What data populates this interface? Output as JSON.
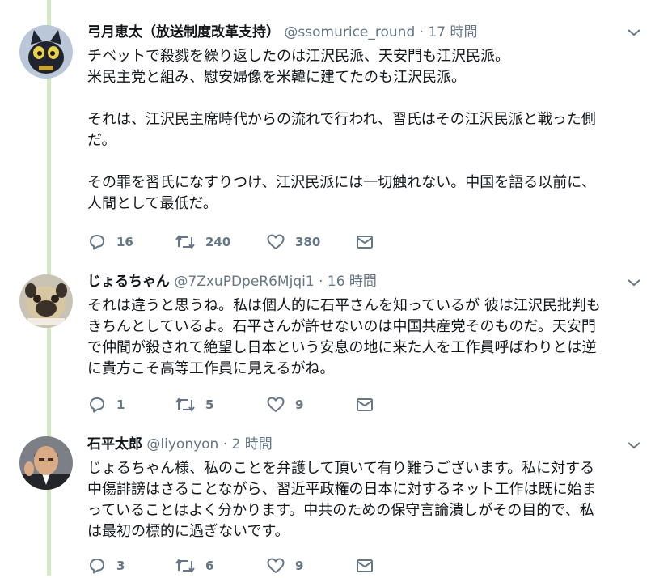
{
  "tweets": [
    {
      "name": "弓月恵太（放送制度改革支持）",
      "handle": "@ssomurice_round",
      "sep": "·",
      "time": "17 時間",
      "paragraphs": [
        "チベットで殺戮を繰り返したのは江沢民派、天安門も江沢民派。\n米民主党と組み、慰安婦像を米韓に建てたのも江沢民派。",
        "それは、江沢民主席時代からの流れで行われ、習氏はその江沢民派と戦った側\nだ。",
        "その罪を習氏になすりつけ、江沢民派には一切触れない。中国を語る以前に、\n人間として最低だ。"
      ],
      "replies": "16",
      "retweets": "240",
      "likes": "380",
      "avatar_icon": "cat-mascot-avatar"
    },
    {
      "name": "じょるちゃん",
      "handle": "@7ZxuPDpeR6Mjqi1",
      "sep": "·",
      "time": "16 時間",
      "paragraphs": [
        "それは違うと思うね。私は個人的に石平さんを知っているが 彼は江沢民批判も\nきちんとしているよ。石平さんが許せないのは中国共産党そのものだ。天安門\nで仲間が殺されて絶望し日本という安息の地に来た人を工作員呼ばわりとは逆\nに貴方こそ高等工作員に見えるがね。"
      ],
      "replies": "1",
      "retweets": "5",
      "likes": "9",
      "avatar_icon": "pug-avatar"
    },
    {
      "name": "石平太郎",
      "handle": "@liyonyon",
      "sep": "·",
      "time": "2 時間",
      "paragraphs": [
        "じょるちゃん様、私のことを弁護して頂いて有り難うございます。私に対する\n中傷誹謗はさることながら、習近平政権の日本に対するネット工作は既に始ま\nっていることはよく分かります。中共のための保守言論潰しがその目的で、私\nは最初の標的に過ぎないです。"
      ],
      "replies": "3",
      "retweets": "6",
      "likes": "9",
      "avatar_icon": "man-portrait-avatar"
    }
  ],
  "colors": {
    "thread_line": "#d3e9c3",
    "icon_gray": "#657786",
    "text": "#14171a"
  }
}
